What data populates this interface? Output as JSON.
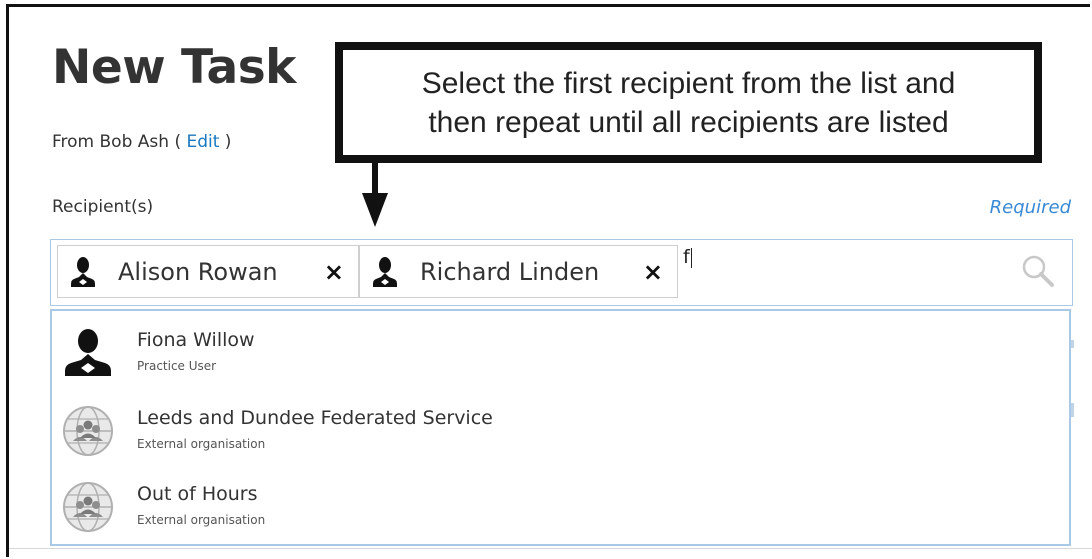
{
  "page": {
    "title": "New Task",
    "from_prefix": "From Bob Ash ( ",
    "from_edit": "Edit",
    "from_suffix": " )",
    "recipients_label": "Recipient(s)",
    "required_label": "Required"
  },
  "callout": {
    "line1": "Select the first recipient from the list and",
    "line2": "then repeat until all recipients are listed"
  },
  "recipients": {
    "selected": [
      {
        "name": "Alison Rowan",
        "icon": "person-icon",
        "remove": "×"
      },
      {
        "name": "Richard Linden",
        "icon": "person-icon",
        "remove": "×"
      }
    ],
    "typed_value": "f",
    "search_icon": "search-icon"
  },
  "dropdown": {
    "options": [
      {
        "name": "Fiona Willow",
        "type": "Practice User",
        "icon": "person-icon"
      },
      {
        "name": "Leeds and Dundee Federated Service",
        "type": "External organisation",
        "icon": "organisation-globe-icon"
      },
      {
        "name": "Out of Hours",
        "type": "External organisation",
        "icon": "organisation-globe-icon"
      }
    ]
  },
  "colors": {
    "link": "#1a78c2",
    "required": "#3a8ad6",
    "input_border": "#a9c9e6",
    "text": "#333333"
  }
}
